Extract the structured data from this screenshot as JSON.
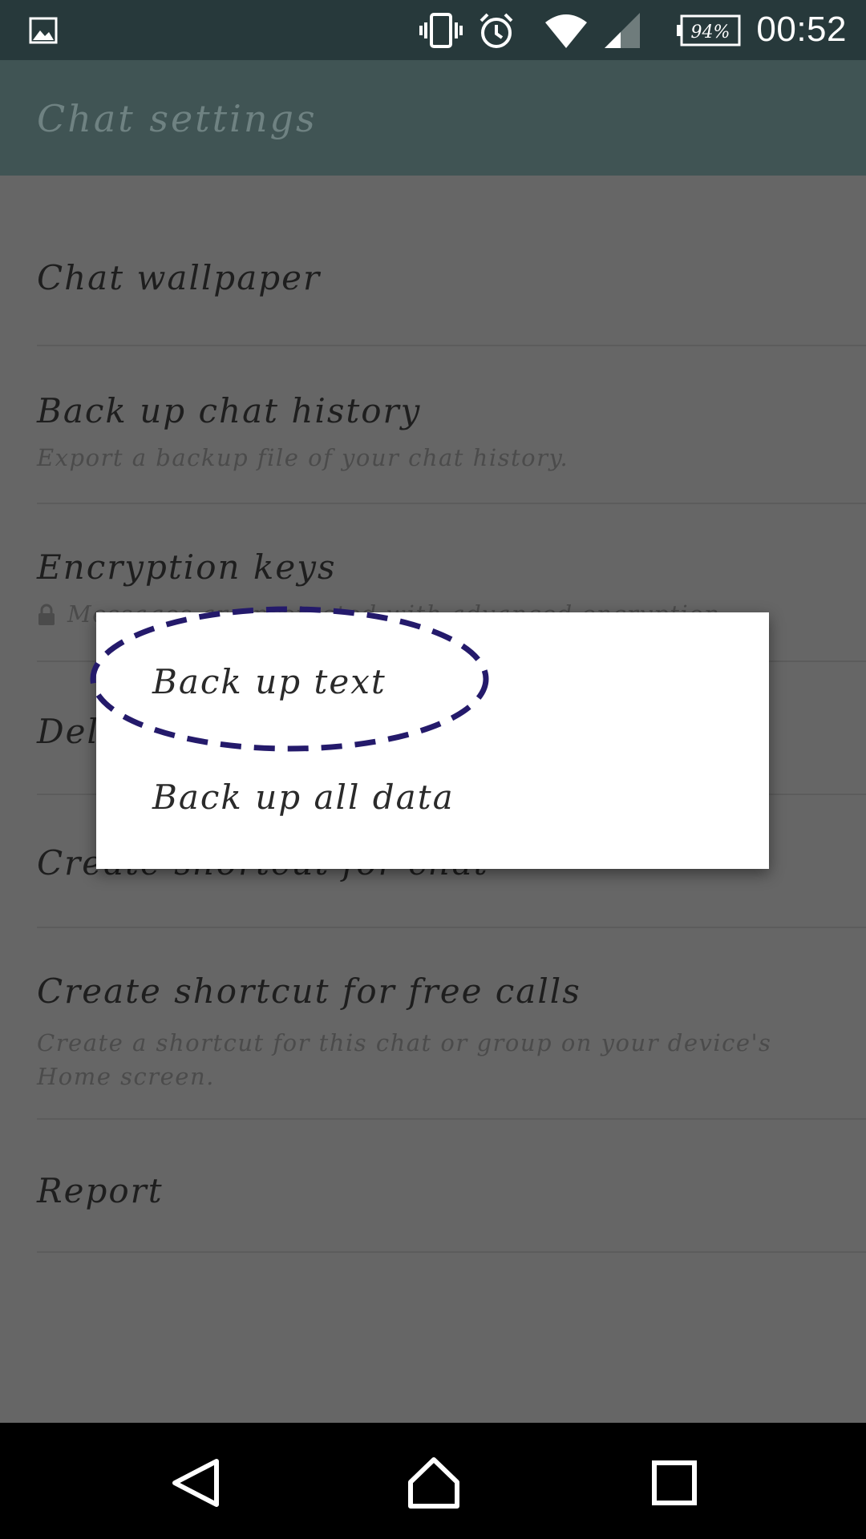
{
  "status_bar": {
    "time": "00:52",
    "battery": "94%",
    "icons": [
      "gallery-icon",
      "vibrate-icon",
      "alarm-icon",
      "wifi-icon",
      "signal-icon",
      "battery-icon"
    ]
  },
  "app_bar": {
    "title": "Chat settings"
  },
  "settings": {
    "chat_wallpaper": {
      "title": "Chat wallpaper"
    },
    "backup": {
      "title": "Back up chat history",
      "subtitle": "Export a backup file of your chat history."
    },
    "encryption": {
      "title": "Encryption keys",
      "subtitle": "Messages are protected with advanced encryption."
    },
    "delete": {
      "title": "Delete chat history"
    },
    "shortcut_chat": {
      "title": "Create shortcut for chat"
    },
    "shortcut_calls": {
      "title": "Create shortcut for free calls",
      "subtitle_line1": "Create a shortcut for this chat or group on your device's",
      "subtitle_line2": "Home screen."
    },
    "report": {
      "title": "Report"
    }
  },
  "dialog": {
    "options": [
      "Back up text",
      "Back up all data"
    ]
  },
  "colors": {
    "status_bar": "#27393b",
    "app_bar": "#405454",
    "dim_overlay": "#666666",
    "highlight": "#241a6b"
  }
}
